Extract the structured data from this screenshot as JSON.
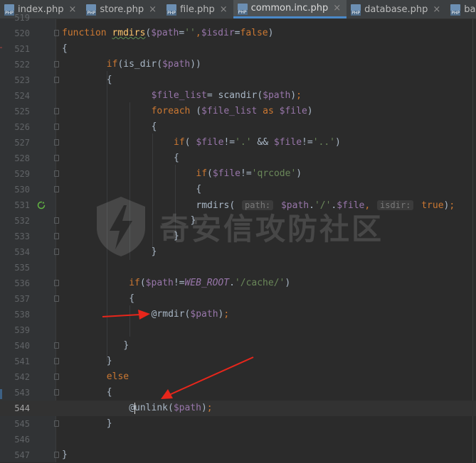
{
  "tabs": [
    {
      "label": "index.php",
      "active": false
    },
    {
      "label": "store.php",
      "active": false
    },
    {
      "label": "file.php",
      "active": false
    },
    {
      "label": "common.inc.php",
      "active": true
    },
    {
      "label": "database.php",
      "active": false
    },
    {
      "label": "baijiacms",
      "active": false
    }
  ],
  "tab_close_glyph": "×",
  "editor": {
    "current_line": 544,
    "first_line": 519,
    "lines": [
      {
        "n": 519,
        "code": ""
      },
      {
        "n": 520,
        "code": "function rmdirs($path='',$isdir=false)"
      },
      {
        "n": 521,
        "code": "{"
      },
      {
        "n": 522,
        "code": "if(is_dir($path))"
      },
      {
        "n": 523,
        "code": "{"
      },
      {
        "n": 524,
        "code": "$file_list= scandir($path);"
      },
      {
        "n": 525,
        "code": "foreach ($file_list as $file)"
      },
      {
        "n": 526,
        "code": "{"
      },
      {
        "n": 527,
        "code": "if( $file!='.' && $file!='..')"
      },
      {
        "n": 528,
        "code": "{"
      },
      {
        "n": 529,
        "code": "if($file!='qrcode')"
      },
      {
        "n": 530,
        "code": "{"
      },
      {
        "n": 531,
        "code": "rmdirs( path: $path.'/'.$file, isdir: true);"
      },
      {
        "n": 532,
        "code": "}"
      },
      {
        "n": 533,
        "code": "}"
      },
      {
        "n": 534,
        "code": "}"
      },
      {
        "n": 535,
        "code": ""
      },
      {
        "n": 536,
        "code": "if($path!=WEB_ROOT.'/cache/')"
      },
      {
        "n": 537,
        "code": "{"
      },
      {
        "n": 538,
        "code": "@rmdir($path);"
      },
      {
        "n": 539,
        "code": ""
      },
      {
        "n": 540,
        "code": "}"
      },
      {
        "n": 541,
        "code": "}"
      },
      {
        "n": 542,
        "code": "else"
      },
      {
        "n": 543,
        "code": "{"
      },
      {
        "n": 544,
        "code": "@unlink($path);"
      },
      {
        "n": 545,
        "code": "}"
      },
      {
        "n": 546,
        "code": ""
      },
      {
        "n": 547,
        "code": "}"
      }
    ]
  },
  "watermark": {
    "text": "奇安信攻防社区"
  },
  "colors": {
    "keyword": "#cc7832",
    "function": "#ffc66d",
    "variable": "#9876aa",
    "string": "#6a8759",
    "arrow": "#e8261b",
    "background": "#2b2b2b"
  },
  "icons": {
    "tab_file": "php-file-icon",
    "gutter_531": "recursive-call-icon",
    "watermark_logo": "lightning-shield-icon"
  }
}
